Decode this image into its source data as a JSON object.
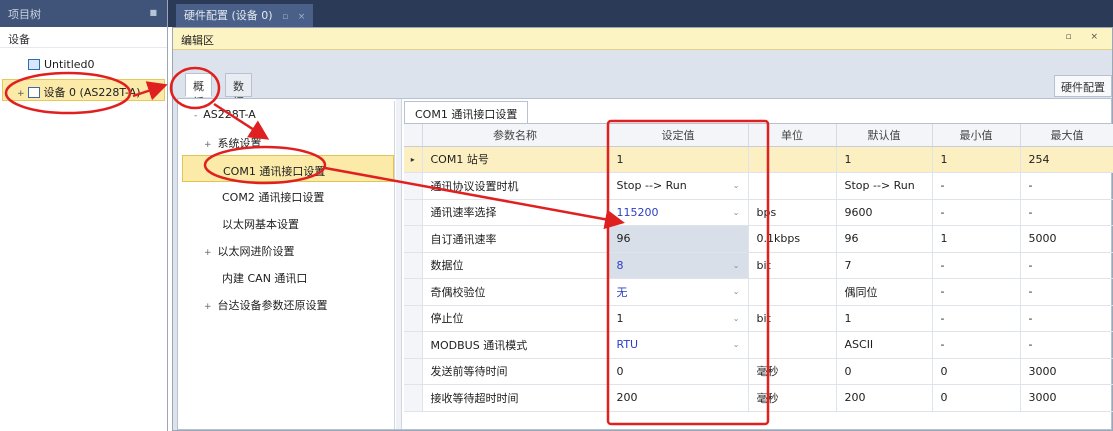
{
  "left_panel": {
    "title": "项目树",
    "section": "设备",
    "items": [
      {
        "label": "Untitled0"
      },
      {
        "label": "设备 0 (AS228T-A)"
      }
    ]
  },
  "document_tab": {
    "label": "硬件配置 (设备 0)",
    "pin": "▫",
    "close": "×"
  },
  "editor": {
    "header": "编辑区",
    "controls": "▫ ×",
    "hw_tab": "硬件配置",
    "tabs": [
      "概括",
      "数据交换"
    ]
  },
  "settings_tree": {
    "root": "AS228T-A",
    "items": [
      {
        "label": "系统设置",
        "expander": "+"
      },
      {
        "label": "COM1 通讯接口设置",
        "selected": true
      },
      {
        "label": "COM2 通讯接口设置"
      },
      {
        "label": "以太网基本设置"
      },
      {
        "label": "以太网进阶设置",
        "expander": "+"
      },
      {
        "label": "内建 CAN 通讯口"
      },
      {
        "label": "台达设备参数还原设置",
        "expander": "+"
      }
    ]
  },
  "grid": {
    "tab": "COM1 通讯接口设置",
    "columns": [
      "参数名称",
      "设定值",
      "单位",
      "默认值",
      "最小值",
      "最大值"
    ],
    "rows": [
      {
        "name": "COM1 站号",
        "value": "1",
        "unit": "",
        "default": "1",
        "min": "1",
        "max": "254"
      },
      {
        "name": "通讯协议设置时机",
        "value": "Stop --> Run",
        "unit": "",
        "default": "Stop --> Run",
        "min": "-",
        "max": "-"
      },
      {
        "name": "通讯速率选择",
        "value": "115200",
        "unit": "bps",
        "default": "9600",
        "min": "-",
        "max": "-"
      },
      {
        "name": "自订通讯速率",
        "value": "96",
        "unit": "0.1kbps",
        "default": "96",
        "min": "1",
        "max": "5000"
      },
      {
        "name": "数据位",
        "value": "8",
        "unit": "bit",
        "default": "7",
        "min": "-",
        "max": "-"
      },
      {
        "name": "奇偶校验位",
        "value": "无",
        "unit": "",
        "default": "偶同位",
        "min": "-",
        "max": "-"
      },
      {
        "name": "停止位",
        "value": "1",
        "unit": "bit",
        "default": "1",
        "min": "-",
        "max": "-"
      },
      {
        "name": "MODBUS 通讯模式",
        "value": "RTU",
        "unit": "",
        "default": "ASCII",
        "min": "-",
        "max": "-"
      },
      {
        "name": "发送前等待时间",
        "value": "0",
        "unit": "毫秒",
        "default": "0",
        "min": "0",
        "max": "3000"
      },
      {
        "name": "接收等待超时时间",
        "value": "200",
        "unit": "毫秒",
        "default": "200",
        "min": "0",
        "max": "3000"
      }
    ]
  },
  "colors": {
    "annotation": "#e02020",
    "selection": "#fbeaa8",
    "title_bar": "#2b3a57",
    "blue_value": "#2a3fc6"
  }
}
